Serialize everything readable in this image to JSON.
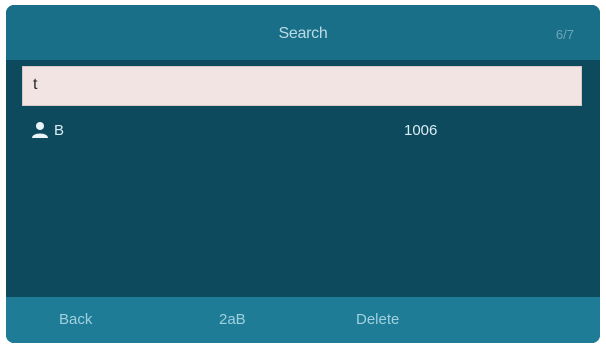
{
  "header": {
    "title": "Search",
    "page_indicator": "6/7"
  },
  "search": {
    "value": "t"
  },
  "results": [
    {
      "icon": "person-icon",
      "name": "B",
      "number": "1006"
    }
  ],
  "softkeys": {
    "back_label": "Back",
    "mode_label": "2aB",
    "delete_label": "Delete"
  },
  "colors": {
    "screen_bg": "#0e4a5e",
    "title_bar": "#1a6f88",
    "softkey_bar": "#1f7c96",
    "search_bg": "#f1e4e2"
  }
}
